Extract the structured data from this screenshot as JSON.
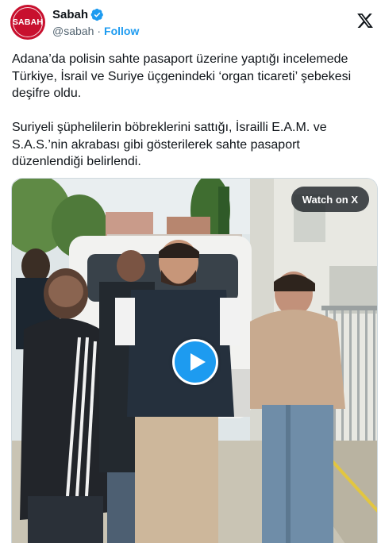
{
  "author": {
    "avatar_text": "SABAH",
    "display_name": "Sabah",
    "handle": "@sabah",
    "separator": "·",
    "follow_label": "Follow",
    "verified": true,
    "brand_color": "#c8102e",
    "verified_color": "#1d9bf0"
  },
  "tweet": {
    "paragraphs": [
      "Adana’da polisin sahte pasaport üzerine yaptığı incelemede Türkiye, İsrail ve Suriye üçgenindeki ‘organ ticareti’ şebekesi deşifre oldu.",
      "Suriyeli şüphelilerin böbreklerini sattığı, İsrailli E.A.M. ve S.A.S.’nin akrabası gibi gösterilerek sahte pasaport düzenlendiği belirlendi."
    ]
  },
  "media": {
    "type": "video",
    "watch_label": "Watch on X",
    "play_icon": "play-icon",
    "play_color": "#1d9bf0"
  },
  "icons": {
    "platform_logo": "x-logo-icon",
    "verified": "verified-badge-icon"
  }
}
